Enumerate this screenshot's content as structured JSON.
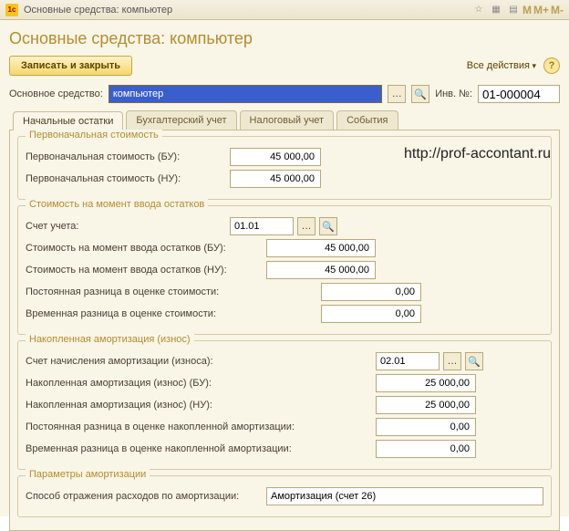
{
  "titlebar": {
    "text": "Основные средства: компьютер",
    "m1": "M",
    "m2": "M+",
    "m3": "M-"
  },
  "page_title": "Основные средства: компьютер",
  "toolbar": {
    "save_close": "Записать и закрыть",
    "all_actions": "Все действия",
    "help": "?"
  },
  "header": {
    "os_label": "Основное средство:",
    "os_value": "компьютер",
    "inv_label": "Инв. №:",
    "inv_value": "01-000004"
  },
  "tabs": [
    "Начальные остатки",
    "Бухгалтерский учет",
    "Налоговый учет",
    "События"
  ],
  "group1": {
    "title": "Первоначальная стоимость",
    "bu_label": "Первоначальная стоимость (БУ):",
    "bu_value": "45 000,00",
    "nu_label": "Первоначальная стоимость (НУ):",
    "nu_value": "45 000,00"
  },
  "group2": {
    "title": "Стоимость на момент ввода остатков",
    "acct_label": "Счет учета:",
    "acct_value": "01.01",
    "bu_label": "Стоимость на момент ввода остатков (БУ):",
    "bu_value": "45 000,00",
    "nu_label": "Стоимость на момент ввода остатков (НУ):",
    "nu_value": "45 000,00",
    "perm_label": "Постоянная разница в оценке стоимости:",
    "perm_value": "0,00",
    "temp_label": "Временная разница в оценке стоимости:",
    "temp_value": "0,00"
  },
  "group3": {
    "title": "Накопленная амортизация (износ)",
    "acct_label": "Счет начисления амортизации (износа):",
    "acct_value": "02.01",
    "bu_label": "Накопленная амортизация (износ) (БУ):",
    "bu_value": "25 000,00",
    "nu_label": "Накопленная амортизация (износ) (НУ):",
    "nu_value": "25 000,00",
    "perm_label": "Постоянная разница в оценке накопленной амортизации:",
    "perm_value": "0,00",
    "temp_label": "Временная разница в оценке накопленной амортизации:",
    "temp_value": "0,00"
  },
  "group4": {
    "title": "Параметры амортизации",
    "method_label": "Способ отражения расходов по амортизации:",
    "method_value": "Амортизация (счет 26)"
  },
  "watermark": "http://prof-accontant.ru"
}
